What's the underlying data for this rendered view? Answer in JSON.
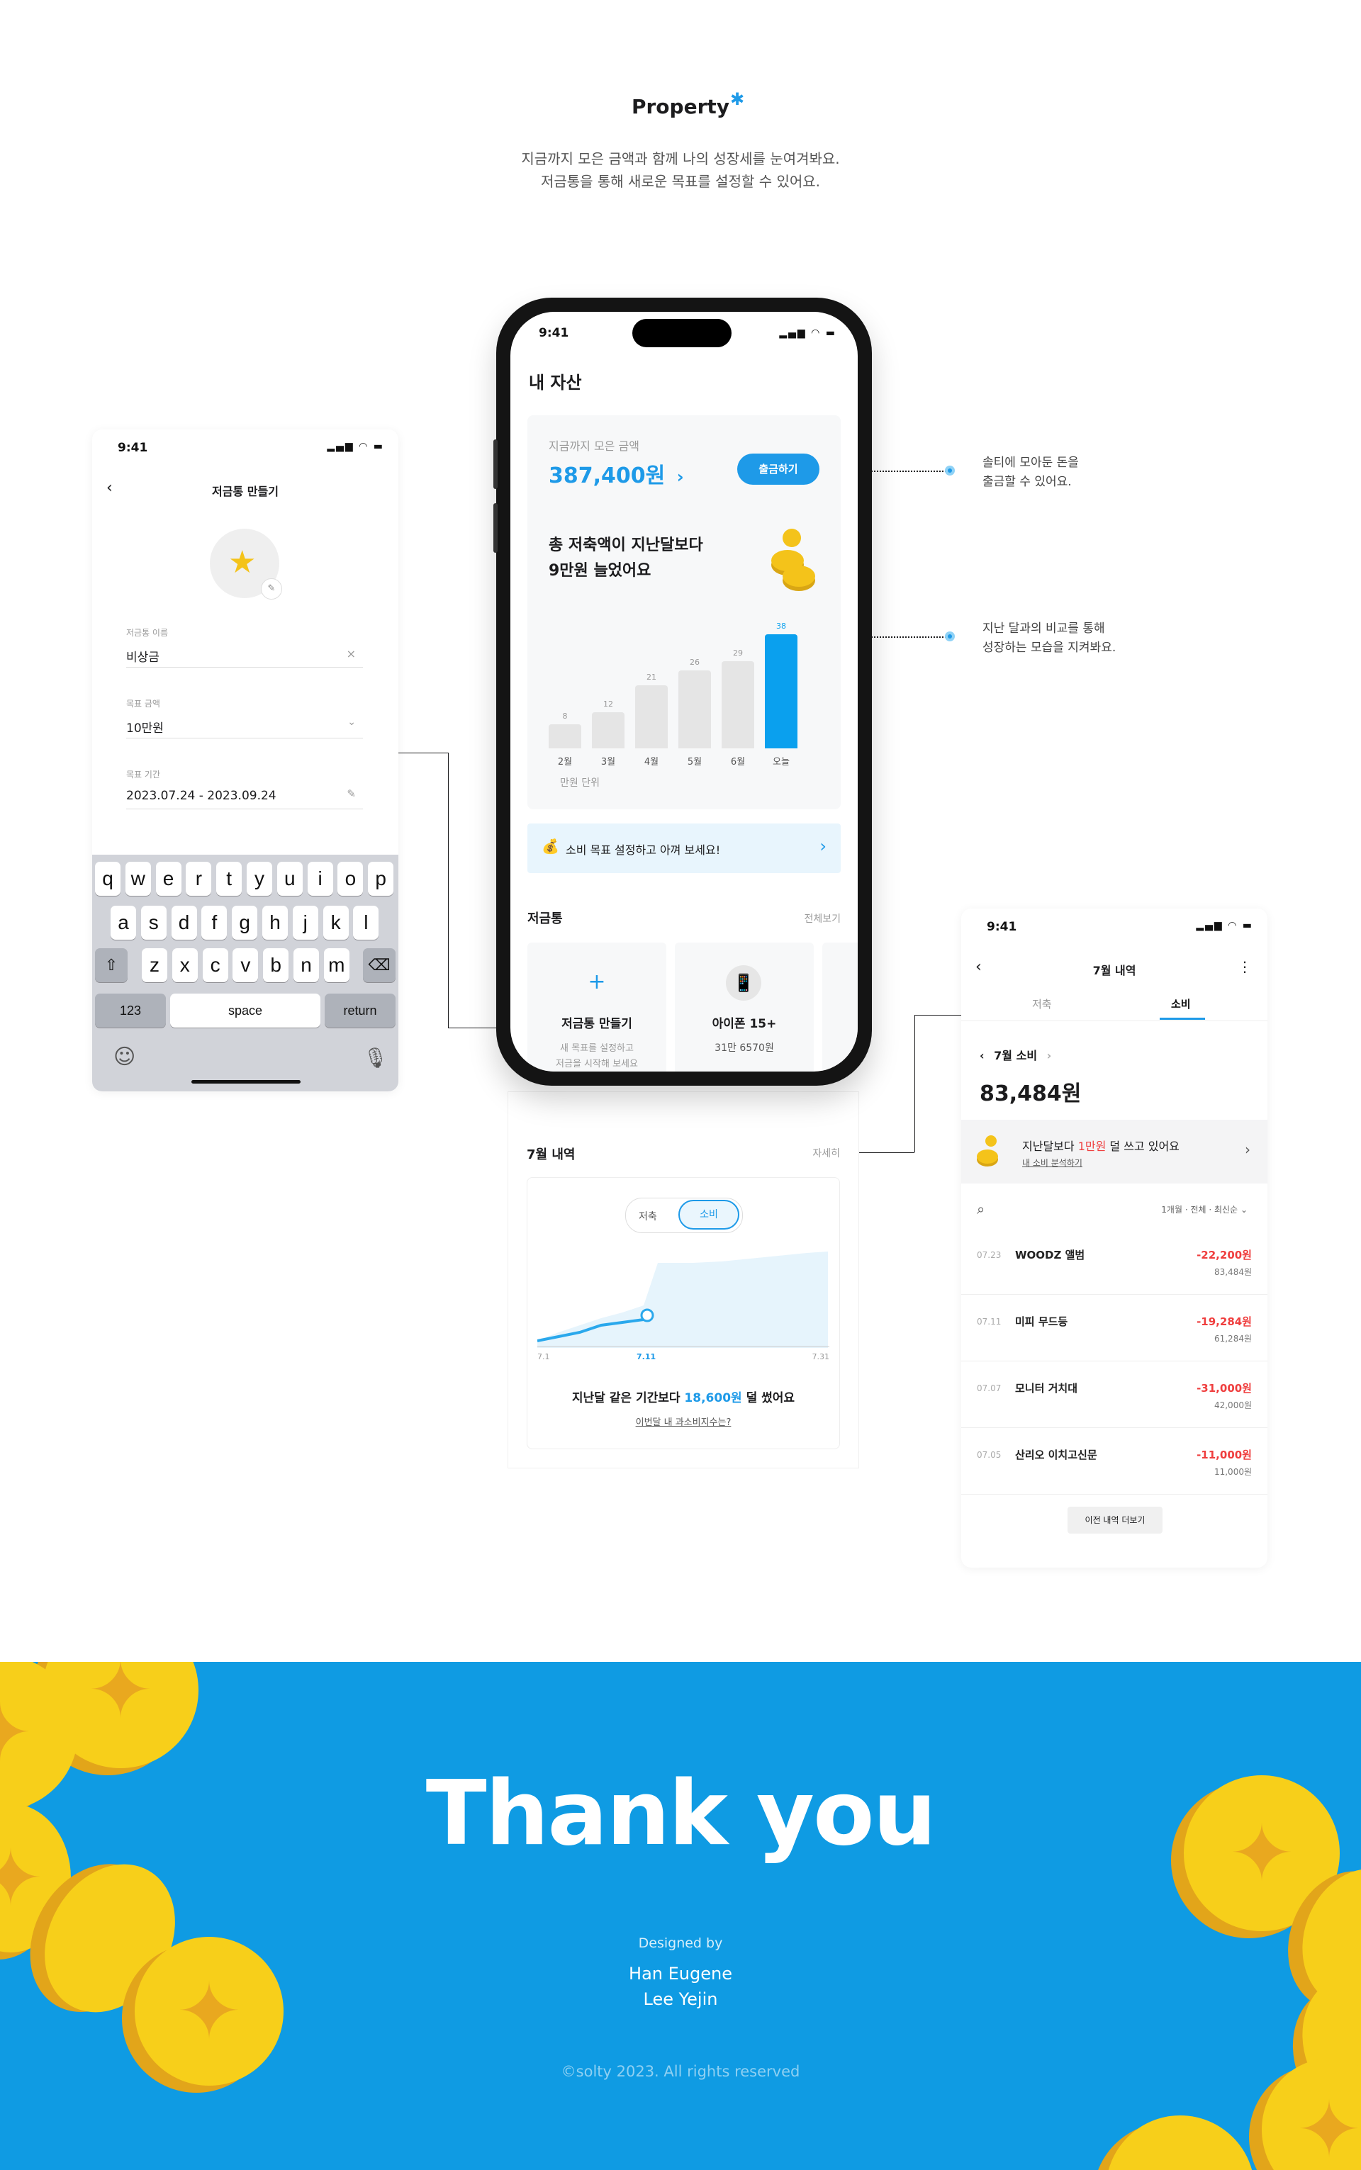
{
  "header": {
    "title": "Property",
    "desc_lines": [
      "지금까지 모은 금액과 함께 나의 성장세를 눈여겨봐요.",
      "저금통을 통해 새로운 목표를 설정할 수 있어요."
    ]
  },
  "left_screen": {
    "status_time": "9:41",
    "title": "저금통 만들기",
    "fields": [
      {
        "label": "저금통 이름",
        "value": "비상금",
        "icon": "clear-icon"
      },
      {
        "label": "목표 금액",
        "value": "10만원",
        "icon": "chevron-down-icon"
      },
      {
        "label": "목표 기간",
        "value": "2023.07.24 - 2023.09.24",
        "icon": "pencil-icon"
      }
    ],
    "keyboard": {
      "row1": [
        "q",
        "w",
        "e",
        "r",
        "t",
        "y",
        "u",
        "i",
        "o",
        "p"
      ],
      "row2": [
        "a",
        "s",
        "d",
        "f",
        "g",
        "h",
        "j",
        "k",
        "l"
      ],
      "row3": [
        "z",
        "x",
        "c",
        "v",
        "b",
        "n",
        "m"
      ],
      "num_key": "123",
      "space_key": "space",
      "return_key": "return"
    }
  },
  "phone": {
    "status_time": "9:41",
    "page_title": "내 자산",
    "total_label": "지금까지 모은 금액",
    "total_value": "387,400원",
    "withdraw_button": "출금하기",
    "compare_line1": "총 저축액이 지난달보다",
    "compare_line2": "9만원 늘었어요",
    "unit_note": "만원 단위",
    "banner_text": "소비 목표 설정하고 아껴 보세요!",
    "piggy_section_title": "저금통",
    "see_all": "전체보기",
    "piggy_cards": [
      {
        "title": "저금통 만들기",
        "sub": "새 목표를 설정하고",
        "sub2": "저금을 시작해 보세요"
      },
      {
        "title": "아이폰 15+",
        "sub": "31만 6570원",
        "sub2": ""
      }
    ]
  },
  "chart_data": {
    "type": "bar",
    "categories": [
      "2월",
      "3월",
      "4월",
      "5월",
      "6월",
      "오늘"
    ],
    "values": [
      8,
      12,
      21,
      26,
      29,
      38
    ],
    "xlabel": "",
    "ylabel": "만원 단위",
    "highlight_index": 5,
    "highlight_color": "#0aa0ee",
    "bar_color": "#e5e5e5"
  },
  "annotations": {
    "top": [
      "솔티에 모아둔 돈을",
      "출금할 수 있어요."
    ],
    "mid": [
      "지난 달과의 비교를 통해",
      "성장하는 모습을 지켜봐요."
    ]
  },
  "july_panel": {
    "title": "7월 내역",
    "detail": "자세히",
    "tabs": [
      "저축",
      "소비"
    ],
    "active_tab": "소비",
    "x_labels": [
      "7.1",
      "7.11",
      "7.31"
    ],
    "summary_prefix": "지난달 같은 기간보다 ",
    "summary_amount": "18,600원",
    "summary_suffix": " 덜 썼어요",
    "link": "이번달 내 과소비지수는?"
  },
  "right_screen": {
    "status_time": "9:41",
    "title": "7월 내역",
    "tabs": [
      "저축",
      "소비"
    ],
    "active_tab": "소비",
    "month_label": "7월 소비",
    "total": "83,484원",
    "compare_prefix": "지난달보다 ",
    "compare_amount": "1만원",
    "compare_suffix": " 덜 쓰고 있어요",
    "compare_link": "내 소비 분석하기",
    "filter": "1개월 · 전체 · 최신순",
    "transactions": [
      {
        "date": "07.23",
        "name": "WOODZ 앨범",
        "amount": "-22,200원",
        "balance": "83,484원"
      },
      {
        "date": "07.11",
        "name": "미피 무드등",
        "amount": "-19,284원",
        "balance": "61,284원"
      },
      {
        "date": "07.07",
        "name": "모니터 거치대",
        "amount": "-31,000원",
        "balance": "42,000원"
      },
      {
        "date": "07.05",
        "name": "산리오 이치고신문",
        "amount": "-11,000원",
        "balance": "11,000원"
      }
    ],
    "more_button": "이전 내역 더보기"
  },
  "footer": {
    "thanks": "Thank you",
    "designed_by": "Designed by",
    "names": [
      "Han Eugene",
      "Lee Yejin"
    ],
    "copyright": "©solty 2023. All rights reserved"
  },
  "colors": {
    "accent": "#1e9ae8",
    "footer_bg": "#0f9be3",
    "red": "#ef3e3e",
    "coin": "#f7cf1a"
  }
}
